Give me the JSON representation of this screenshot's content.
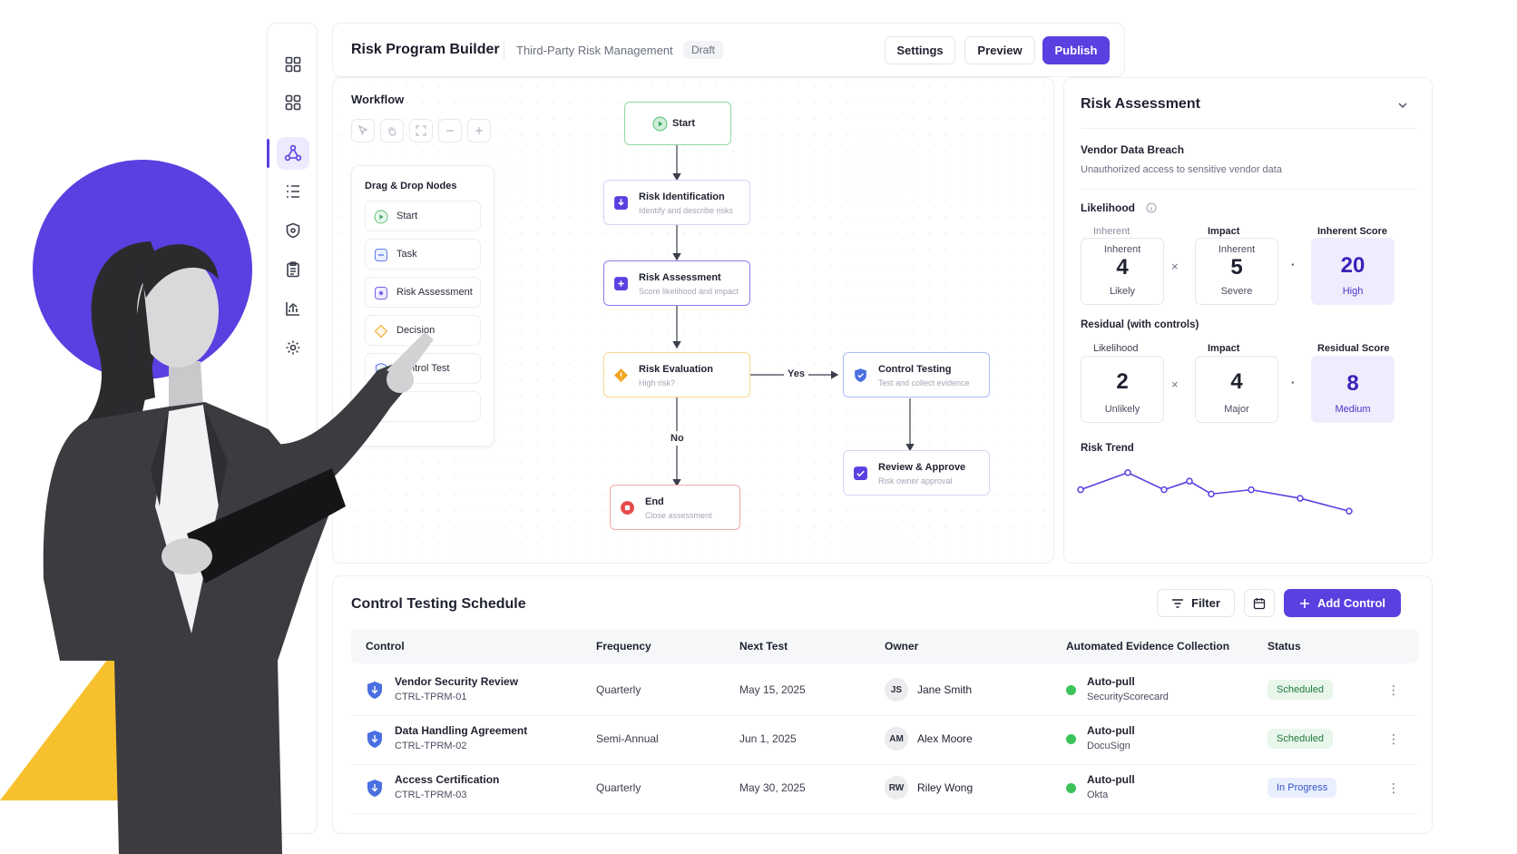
{
  "header": {
    "title": "Risk Program Builder",
    "subtitle": "Third-Party Risk Management",
    "badge": "Draft",
    "buttons": {
      "settings": "Settings",
      "preview": "Preview",
      "publish": "Publish"
    }
  },
  "sidebar": {
    "items": [
      {
        "icon": "grid-icon"
      },
      {
        "icon": "grid-icon"
      },
      {
        "icon": "workflow-icon",
        "active": true
      },
      {
        "icon": "list-icon"
      },
      {
        "icon": "shield-icon"
      },
      {
        "icon": "clipboard-icon"
      },
      {
        "icon": "chart-icon"
      },
      {
        "icon": "gear-icon"
      }
    ]
  },
  "workflow": {
    "title": "Workflow",
    "palette": {
      "title": "Drag & Drop Nodes",
      "items": [
        {
          "label": "Start",
          "icon": "play-icon"
        },
        {
          "label": "Task",
          "icon": "task-icon"
        },
        {
          "label": "Risk Assessment",
          "icon": "risk-icon"
        },
        {
          "label": "Decision",
          "icon": "diamond-icon"
        },
        {
          "label": "Control Test",
          "icon": "shield-icon"
        },
        {
          "label": "",
          "icon": "end-icon"
        }
      ]
    },
    "nodes": {
      "start": {
        "title": "Start"
      },
      "risk_id": {
        "title": "Risk Identification",
        "sub": "Identify and describe risks"
      },
      "risk_assess": {
        "title": "Risk Assessment",
        "sub": "Score likelihood and impact"
      },
      "risk_eval": {
        "title": "Risk Evaluation",
        "sub": "High risk?"
      },
      "control_test": {
        "title": "Control Testing",
        "sub": "Test and collect evidence"
      },
      "review": {
        "title": "Review & Approve",
        "sub": "Risk owner approval"
      },
      "end": {
        "title": "End",
        "sub": "Close assessment"
      }
    },
    "edges": {
      "yes": "Yes",
      "no": "No"
    }
  },
  "risk_panel": {
    "title": "Risk Assessment",
    "risk_name": "Vendor Data Breach",
    "risk_desc": "Unauthorized access to sensitive vendor data",
    "likelihood_label": "Likelihood",
    "inherent": {
      "col1": "Inherent",
      "col2": "Impact",
      "col3": "Inherent Score",
      "likelihood": {
        "top": "Inherent",
        "value": "4",
        "label": "Likely"
      },
      "impact": {
        "top": "Inherent",
        "value": "5",
        "label": "Severe"
      },
      "score": {
        "value": "20",
        "label": "High"
      }
    },
    "residual": {
      "heading": "Residual (with controls)",
      "col1": "Likelihood",
      "col2": "Impact",
      "col3": "Residual Score",
      "likelihood": {
        "value": "2",
        "label": "Unlikely"
      },
      "impact": {
        "value": "4",
        "label": "Major"
      },
      "score": {
        "value": "8",
        "label": "Medium"
      }
    },
    "operators": {
      "times": "×",
      "equals": "·"
    },
    "trend_label": "Risk Trend",
    "trend_values": [
      14,
      18,
      14,
      16,
      13,
      14,
      12,
      9
    ],
    "colors": {
      "accent": "#5b3fe0"
    }
  },
  "schedule": {
    "title": "Control Testing Schedule",
    "filter_label": "Filter",
    "add_label": "Add Control",
    "columns": [
      "Control",
      "Frequency",
      "Next Test",
      "Owner",
      "Automated Evidence Collection",
      "Status"
    ],
    "rows": [
      {
        "name": "Vendor Security Review",
        "id": "CTRL-TPRM-01",
        "frequency": "Quarterly",
        "next": "May 15, 2025",
        "initials": "JS",
        "owner": "Jane Smith",
        "ev": "Auto-pull",
        "src": "SecurityScorecard",
        "status": "Scheduled",
        "status_type": "sched"
      },
      {
        "name": "Data Handling Agreement",
        "id": "CTRL-TPRM-02",
        "frequency": "Semi-Annual",
        "next": "Jun 1, 2025",
        "initials": "AM",
        "owner": "Alex Moore",
        "ev": "Auto-pull",
        "src": "DocuSign",
        "status": "Scheduled",
        "status_type": "sched"
      },
      {
        "name": "Access Certification",
        "id": "CTRL-TPRM-03",
        "frequency": "Quarterly",
        "next": "May 30, 2025",
        "initials": "RW",
        "owner": "Riley Wong",
        "ev": "Auto-pull",
        "src": "Okta",
        "status": "In Progress",
        "status_type": "prog"
      }
    ]
  }
}
